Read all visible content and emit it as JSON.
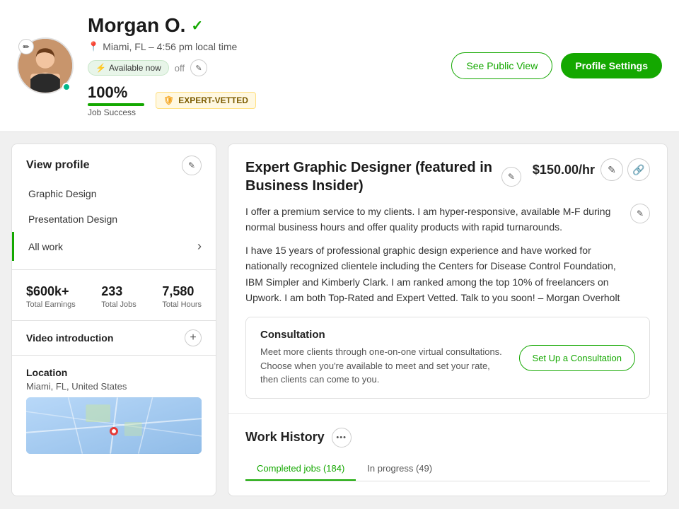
{
  "header": {
    "name": "Morgan O.",
    "verified": true,
    "location": "Miami, FL – 4:56 pm local time",
    "availability_label": "Available now",
    "availability_status": "off",
    "job_success_pct": "100%",
    "job_success_label": "Job Success",
    "expert_vetted_label": "EXPERT-VETTED",
    "btn_see_public": "See Public View",
    "btn_profile_settings": "Profile Settings"
  },
  "sidebar": {
    "view_profile_title": "View profile",
    "nav_items": [
      {
        "label": "Graphic Design",
        "active": false
      },
      {
        "label": "Presentation Design",
        "active": false
      },
      {
        "label": "All work",
        "active": true,
        "has_arrow": true
      }
    ],
    "stats": [
      {
        "value": "$600k+",
        "label": "Total Earnings"
      },
      {
        "value": "233",
        "label": "Total Jobs"
      },
      {
        "value": "7,580",
        "label": "Total Hours"
      }
    ],
    "video_intro_title": "Video introduction",
    "location_title": "Location",
    "location_text": "Miami, FL, United States"
  },
  "content": {
    "job_title": "Expert Graphic Designer (featured in Business Insider)",
    "rate": "$150.00/hr",
    "bio_para1": "I offer a premium service to my clients. I am hyper-responsive, available M-F during normal business hours and offer quality products with rapid turnarounds.",
    "bio_para2": "I have 15 years of professional graphic design experience and have worked for nationally recognized clientele including the Centers for Disease Control Foundation, IBM Simpler and Kimberly Clark. I am ranked among the top 10% of freelancers on Upwork. I am both Top-Rated and Expert Vetted. Talk to you soon! – Morgan Overholt",
    "consultation": {
      "title": "Consultation",
      "desc": "Meet more clients through one-on-one virtual consultations. Choose when you're available to meet and set your rate, then clients can come to you.",
      "btn_label": "Set Up a Consultation"
    },
    "work_history": {
      "title": "Work History",
      "tabs": [
        {
          "label": "Completed jobs (184)",
          "active": true
        },
        {
          "label": "In progress (49)",
          "active": false
        }
      ]
    }
  },
  "icons": {
    "edit": "✏",
    "location_pin": "📍",
    "bolt": "⚡",
    "pencil": "✎",
    "link": "🔗",
    "plus": "+",
    "chevron_right": "›",
    "more": "•••",
    "shield": "🛡",
    "verified_check": "✓"
  }
}
